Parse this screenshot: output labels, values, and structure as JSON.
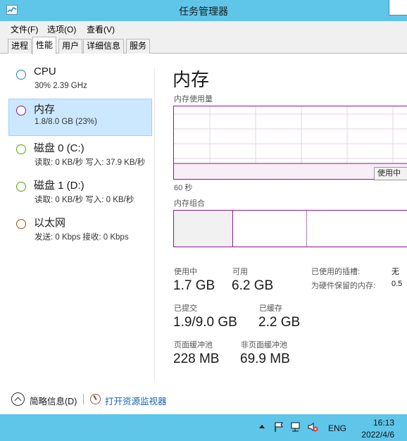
{
  "window": {
    "title": "任务管理器"
  },
  "menu": [
    "文件(F)",
    "选项(O)",
    "查看(V)"
  ],
  "tabs": [
    "进程",
    "性能",
    "用户",
    "详细信息",
    "服务"
  ],
  "active_tab_index": 1,
  "sidebar": {
    "items": [
      {
        "name": "CPU",
        "sub": "30%  2.39 GHz",
        "color": "#1a7fc4"
      },
      {
        "name": "内存",
        "sub": "1.8/8.0 GB (23%)",
        "color": "#8b1a8b"
      },
      {
        "name": "磁盘 0 (C:)",
        "sub": "读取: 0 KB/秒 写入: 37.9 KB/秒",
        "color": "#4da60c"
      },
      {
        "name": "磁盘 1 (D:)",
        "sub": "读取: 0 KB/秒 写入: 0 KB/秒",
        "color": "#4da60c"
      },
      {
        "name": "以太网",
        "sub": "发送: 0 Kbps 接收: 0 Kbps",
        "color": "#a74f01"
      }
    ],
    "selected_index": 1
  },
  "main": {
    "title": "内存",
    "usage_label": "内存使用量",
    "time_label": "60 秒",
    "tooltip": "使用中",
    "composition_label": "内存组合",
    "stats": {
      "in_use_label": "使用中",
      "in_use": "1.7 GB",
      "available_label": "可用",
      "available": "6.2 GB",
      "committed_label": "已提交",
      "committed": "1.9/9.0 GB",
      "cached_label": "已缓存",
      "cached": "2.2 GB",
      "paged_label": "页面缓冲池",
      "paged": "228 MB",
      "nonpaged_label": "非页面缓冲池",
      "nonpaged": "69.9 MB",
      "slots_label": "已使用的插槽:",
      "slots": "无",
      "reserved_label": "为硬件保留的内存:",
      "reserved": "0.5"
    }
  },
  "footer": {
    "fewer_details": "简略信息(D)",
    "open_resmon": "打开资源监视器"
  },
  "taskbar": {
    "lang": "ENG",
    "time": "16:13",
    "date": "2022/4/6"
  },
  "colors": {
    "accent": "#5fc6e9",
    "memory": "#8b1a8b",
    "selection": "#cce8ff"
  }
}
